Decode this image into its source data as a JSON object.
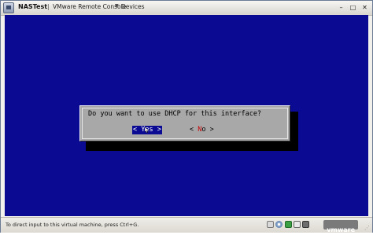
{
  "window": {
    "title": "NASTest",
    "menu": [
      {
        "label": "VMware Remote Console"
      },
      {
        "label": "Devices"
      }
    ],
    "controls": {
      "minimize": "–",
      "maximize": "□",
      "close": "✕"
    }
  },
  "console": {
    "background": "#0a0b92",
    "dialog": {
      "question": "Do you want to use DHCP for this interface?",
      "yes_label": "< Yes >",
      "no_label": "< No >",
      "yes_hotkey": "Y",
      "no_hotkey": "N",
      "selected": "Yes"
    }
  },
  "statusbar": {
    "hint": "To direct input to this virtual machine, press Ctrl+G.",
    "icons": [
      "hard-disk-icon",
      "cd-rom-icon",
      "network-icon",
      "usb-icon",
      "floppy-icon",
      "sound-icon"
    ],
    "brand": "vmware"
  }
}
